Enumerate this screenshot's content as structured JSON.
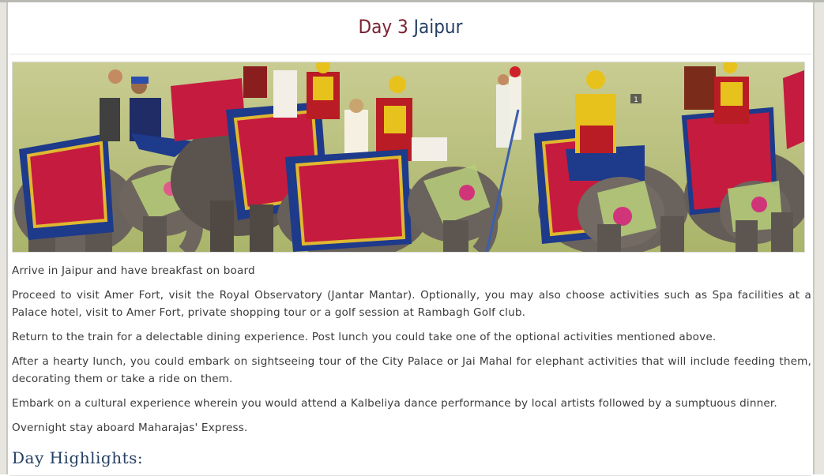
{
  "heading": {
    "day_label": "Day 3",
    "city_label": "Jaipur"
  },
  "photo": {
    "description": "elephant-festival-photo",
    "badge": "1"
  },
  "paragraphs": [
    "Arrive in Jaipur and have breakfast on board",
    "Proceed to visit Amer Fort, visit the Royal Observatory (Jantar Mantar). Optionally, you may also choose activities such as Spa facilities at a Palace hotel, visit to Amer Fort, private shopping tour or a golf session at Rambagh Golf club.",
    "Return to the train for a delectable dining experience. Post lunch you could take one of the optional activities mentioned above.",
    "After a hearty lunch, you could embark on sightseeing tour of the City Palace or Jai Mahal for elephant activities that will include feeding them, decorating them or take a ride on them.",
    "Embark on a cultural experience wherein you would attend a Kalbeliya dance performance by local artists followed by a sumptuous dinner.",
    "Overnight stay aboard Maharajas' Express."
  ],
  "section": {
    "highlights_title": "Day Highlights:"
  },
  "colors": {
    "day_color": "#7a2233",
    "city_color": "#243f63",
    "body_text": "#3b3b3b",
    "grass": "#b7bd7a"
  }
}
